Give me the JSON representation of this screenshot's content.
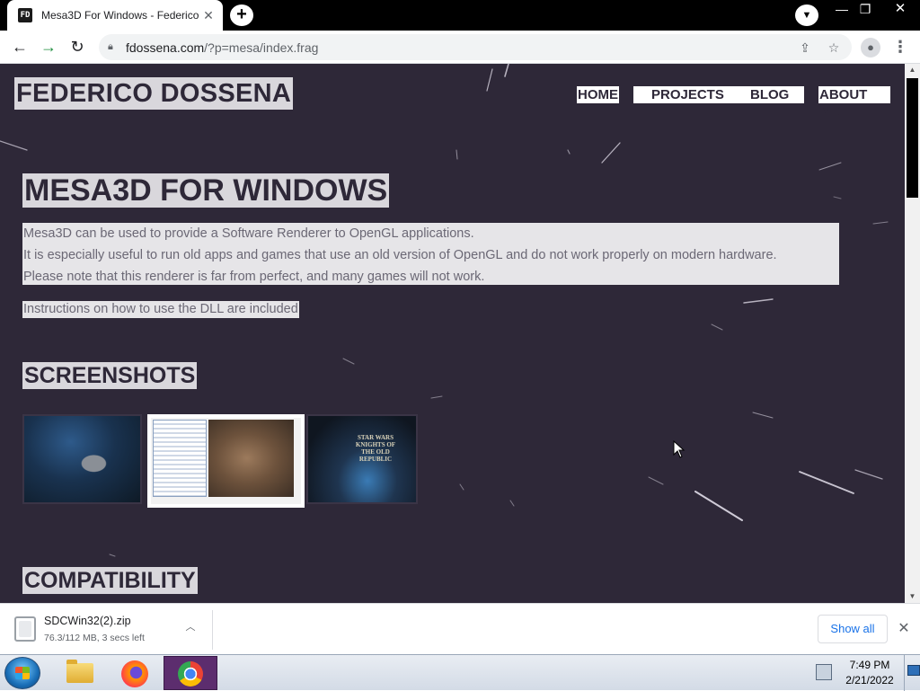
{
  "browser": {
    "tab": {
      "favicon_text": "FD",
      "title": "Mesa3D For Windows - Federico",
      "close_icon": "close-icon"
    },
    "new_tab_icon": "plus-icon",
    "tab_search_icon": "chevron-down-icon",
    "window": {
      "minimize": "—",
      "maximize": "❐",
      "close": "✕"
    },
    "toolbar": {
      "back_icon": "arrow-left-icon",
      "forward_icon": "arrow-right-icon",
      "reload_icon": "reload-icon",
      "url_host": "fdossena.com",
      "url_path": "/?p=mesa/index.frag",
      "share_icon": "share-icon",
      "bookmark_icon": "star-icon",
      "profile_icon": "person-icon",
      "menu_icon": "kebab-menu-icon"
    }
  },
  "page": {
    "brand": "FEDERICO DOSSENA",
    "nav": {
      "home": "HOME",
      "projects": "PROJECTS",
      "blog": "BLOG",
      "about": "ABOUT ME"
    },
    "heading": "MESA3D FOR WINDOWS",
    "intro": [
      "Mesa3D can be used to provide a Software Renderer to OpenGL applications.",
      "It is especially useful to run old apps and games that use an old version of OpenGL and do not work properly on modern hardware.",
      "Please note that this renderer is far from perfect, and many games will not work."
    ],
    "note": "Instructions on how to use the DLL are included",
    "screenshots_heading": "SCREENSHOTS",
    "screenshot_3_logo": "STAR WARS KNIGHTS OF THE OLD REPUBLIC",
    "compatibility_heading": "COMPATIBILITY",
    "background_color": "#2e2838"
  },
  "download_bar": {
    "file_name": "SDCWin32(2).zip",
    "status": "76.3/112 MB, 3 secs left",
    "progress_fraction": 0.68,
    "show_all": "Show all",
    "close_icon": "close-icon"
  },
  "taskbar": {
    "start_icon": "windows-start-icon",
    "pinned": [
      "file-explorer-icon",
      "firefox-icon",
      "chrome-icon"
    ],
    "active": "chrome-icon",
    "tray_icon": "network-icon",
    "time": "7:49 PM",
    "date": "2/21/2022"
  }
}
